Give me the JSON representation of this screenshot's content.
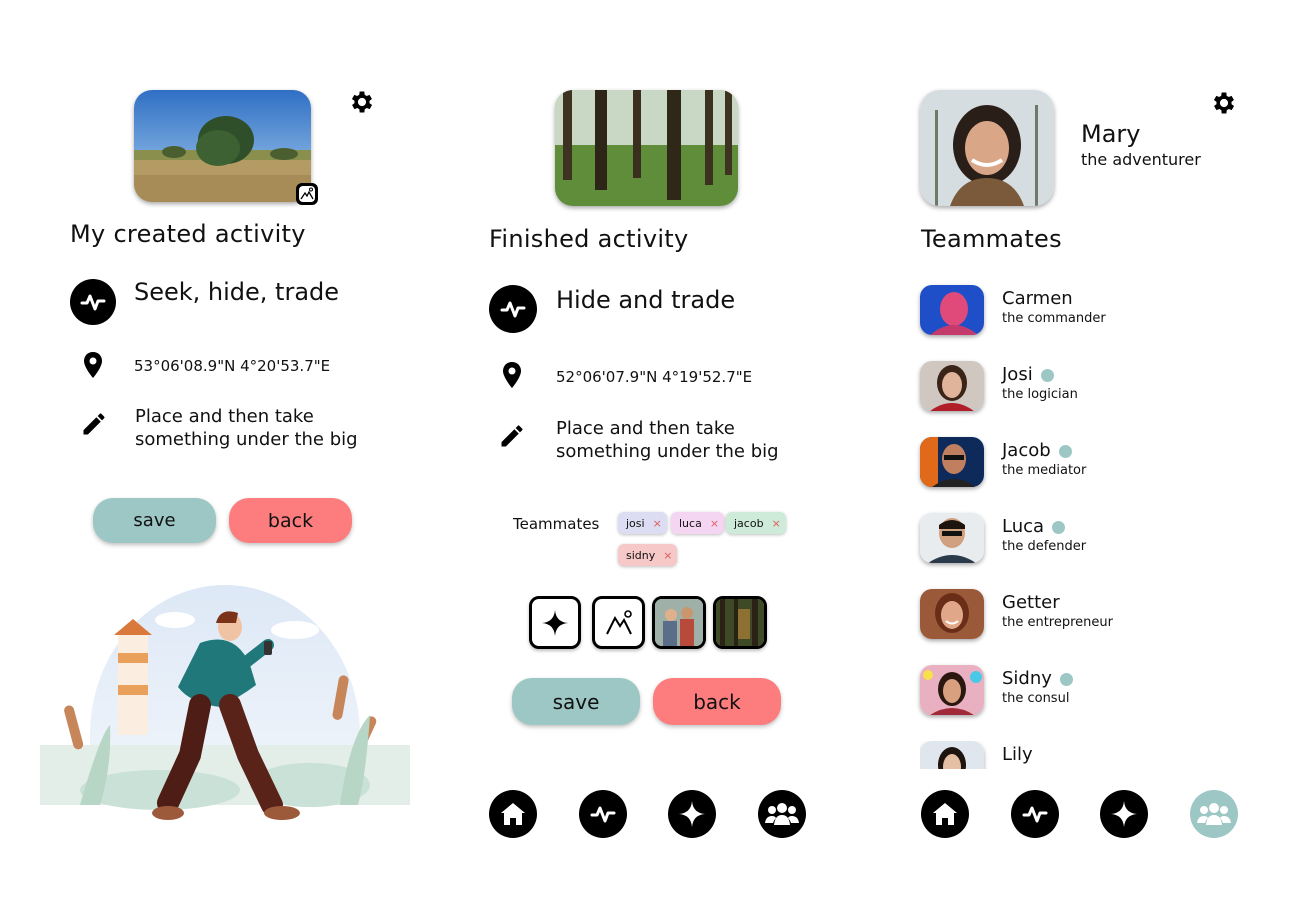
{
  "colors": {
    "accent_teal": "#9cc7c5",
    "accent_coral": "#fd7d7e",
    "icon_black": "#000000",
    "chip_josi": "#dcdcf2",
    "chip_luca": "#f5d6f2",
    "chip_jacob": "#cdebd8",
    "chip_sidny": "#f7c8c8"
  },
  "panel1": {
    "heading": "My created activity",
    "activity_name": "Seek, hide, trade",
    "coordinates": "53°06'08.9\"N 4°20'53.7\"E",
    "description_line1": "Place and then take",
    "description_line2": "something under the big",
    "save_label": "save",
    "back_label": "back",
    "icons": [
      "gear-icon",
      "activity-pulse-icon",
      "location-pin-icon",
      "pencil-icon",
      "image-icon"
    ]
  },
  "panel2": {
    "heading": "Finished activity",
    "activity_name": "Hide and trade",
    "coordinates": "52°06'07.9\"N 4°19'52.7\"E",
    "description_line1": "Place and then take",
    "description_line2": "something under the big",
    "teammates_label": "Teammates",
    "chips": [
      {
        "label": "josi",
        "remove": "×"
      },
      {
        "label": "luca",
        "remove": "×"
      },
      {
        "label": "jacob",
        "remove": "×"
      },
      {
        "label": "sidny",
        "remove": "×"
      }
    ],
    "save_label": "save",
    "back_label": "back"
  },
  "panel3": {
    "profile_name": "Mary",
    "profile_role": "the adventurer",
    "heading": "Teammates",
    "teammates": [
      {
        "name": "Carmen",
        "role": "the commander",
        "online": false
      },
      {
        "name": "Josi",
        "role": "the logician",
        "online": true
      },
      {
        "name": "Jacob",
        "role": "the mediator",
        "online": true
      },
      {
        "name": "Luca",
        "role": "the defender",
        "online": true
      },
      {
        "name": "Getter",
        "role": "the entrepreneur",
        "online": false
      },
      {
        "name": "Sidny",
        "role": "the consul",
        "online": true
      },
      {
        "name": "Lily",
        "role": "",
        "online": false
      }
    ]
  },
  "nav": {
    "items": [
      "home-icon",
      "activity-pulse-icon",
      "sparkle-add-icon",
      "team-icon"
    ],
    "active_panel3": "team-icon"
  }
}
